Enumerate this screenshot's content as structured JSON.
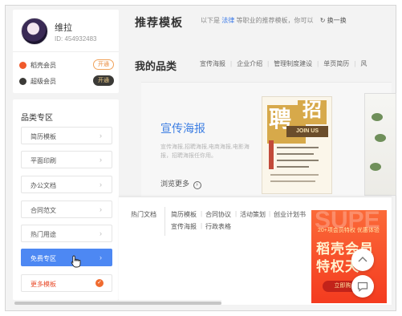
{
  "user": {
    "name": "维拉",
    "id_text": "ID: 454932483",
    "vip_rows": [
      {
        "label": "稻壳会员",
        "button": "开通",
        "icon_color": "#f05a2c"
      },
      {
        "label": "超级会员",
        "button": "开通",
        "icon_color": "#3b3a37"
      }
    ]
  },
  "sidebar": {
    "title": "品类专区",
    "items": [
      {
        "label": "简历模板"
      },
      {
        "label": "平面印刷"
      },
      {
        "label": "办公文档"
      },
      {
        "label": "合同范文"
      },
      {
        "label": "热门用途"
      },
      {
        "label": "免费专区"
      },
      {
        "label": "更多模板"
      }
    ],
    "arrow": "›"
  },
  "header": {
    "title": "推荐模板",
    "desc_prefix": "以下是",
    "desc_link": "法律",
    "desc_suffix": "等职业的推荐模板，你可以",
    "refresh_label": "换一换",
    "refresh_icon": "refresh-icon"
  },
  "my_category": {
    "title": "我的品类",
    "tabs": [
      "宣传海报",
      "企业介绍",
      "管理制度建设",
      "单页简历",
      "风"
    ]
  },
  "banner": {
    "title": "宣传海报",
    "text": "宣传海报,招聘海报,电商海报,电影海报，招聘海报任你用。",
    "browse_label": "浏览更多",
    "poster": {
      "zh_a": "聘",
      "zh_b": "招",
      "join": "JOIN US"
    }
  },
  "dropdown": {
    "hot_label": "热门文档",
    "row1": [
      "简历模板",
      "合同协议",
      "活动策划",
      "创业计划书"
    ],
    "row2": [
      "宣传海报",
      "行政表格"
    ]
  },
  "ad": {
    "bg_text": "SUPE",
    "small": "20+项会员特权 优惠体验",
    "line1": "稻壳会员",
    "line2": "特权天",
    "buy": "立即购"
  },
  "colors": {
    "accent": "#4d88f3",
    "link": "#3d7be8",
    "ad_red": "#f43b1f"
  }
}
